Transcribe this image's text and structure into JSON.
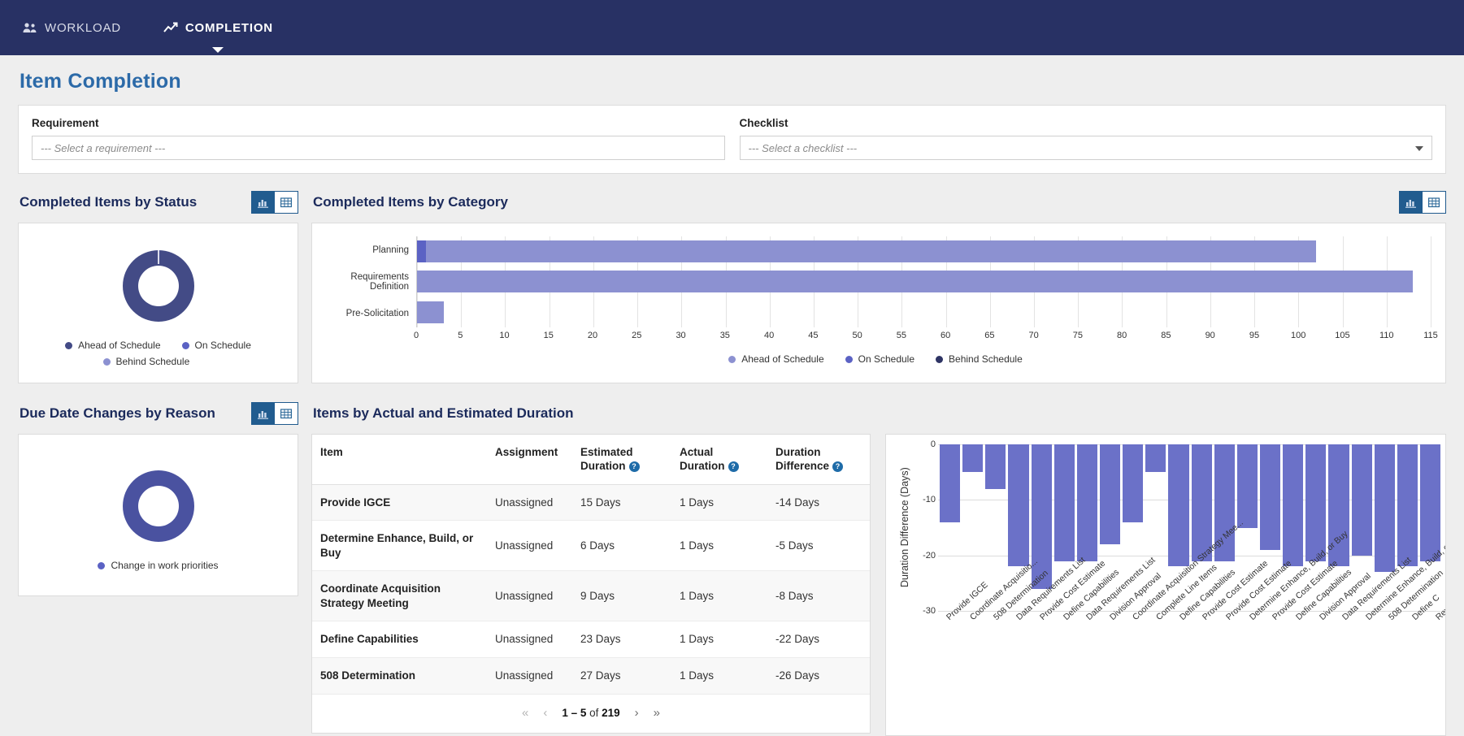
{
  "nav": {
    "items": [
      {
        "label": "WORKLOAD",
        "icon": "users-icon",
        "active": false
      },
      {
        "label": "COMPLETION",
        "icon": "line-chart-icon",
        "active": true
      }
    ]
  },
  "page": {
    "title": "Item Completion"
  },
  "filters": {
    "requirement": {
      "label": "Requirement",
      "value": "--- Select a requirement ---"
    },
    "checklist": {
      "label": "Checklist",
      "value": "--- Select a checklist ---"
    }
  },
  "colors": {
    "nav_bg": "#283164",
    "title_blue": "#2c6aa8",
    "toggle_active": "#215c8f",
    "ahead": "#8c91d1",
    "on": "#5b62c4",
    "behind": "#2e3464",
    "donut_status": "#434b86",
    "donut_reason": "#4a52a0",
    "dur_bar": "#6b71c8"
  },
  "status_panel": {
    "title": "Completed Items by Status",
    "toggles": [
      {
        "name": "chart-view",
        "icon": "bar-chart-icon",
        "active": true
      },
      {
        "name": "table-view",
        "icon": "table-icon",
        "active": false
      }
    ],
    "chart_data": {
      "type": "pie",
      "title": "Completed Items by Status",
      "labels": [
        "Ahead of Schedule",
        "On Schedule",
        "Behind Schedule"
      ],
      "values": [
        218,
        1,
        0
      ],
      "colors": [
        "#434b86",
        "#5b62c4",
        "#8c91d1"
      ],
      "legend": "bottom"
    }
  },
  "reason_panel": {
    "title": "Due Date Changes by Reason",
    "toggles": [
      {
        "name": "chart-view",
        "icon": "bar-chart-icon",
        "active": true
      },
      {
        "name": "table-view",
        "icon": "table-icon",
        "active": false
      }
    ],
    "chart_data": {
      "type": "pie",
      "title": "Due Date Changes by Reason",
      "labels": [
        "Change in work priorities"
      ],
      "values": [
        100
      ],
      "colors": [
        "#4a52a0"
      ],
      "legend": "bottom"
    }
  },
  "category_panel": {
    "title": "Completed Items by Category",
    "toggles": [
      {
        "name": "chart-view",
        "icon": "bar-chart-icon",
        "active": true
      },
      {
        "name": "table-view",
        "icon": "table-icon",
        "active": false
      }
    ],
    "chart_data": {
      "type": "bar",
      "orientation": "horizontal",
      "stacked": true,
      "title": "Completed Items by Category",
      "categories": [
        "Planning",
        "Requirements Definition",
        "Pre-Solicitation"
      ],
      "series": [
        {
          "name": "Ahead of Schedule",
          "color": "#8c91d1",
          "values": [
            101,
            113,
            3
          ]
        },
        {
          "name": "On Schedule",
          "color": "#5b62c4",
          "values": [
            1,
            0,
            0
          ]
        },
        {
          "name": "Behind Schedule",
          "color": "#2e3464",
          "values": [
            0,
            0,
            0
          ]
        }
      ],
      "xlabel": "",
      "ylabel": "",
      "xlim": [
        0,
        115
      ],
      "xticks": [
        0,
        5,
        10,
        15,
        20,
        25,
        30,
        35,
        40,
        45,
        50,
        55,
        60,
        65,
        70,
        75,
        80,
        85,
        90,
        95,
        100,
        105,
        110,
        115
      ],
      "grid": true,
      "legend": "bottom"
    }
  },
  "duration_panel": {
    "title": "Items by Actual and Estimated Duration",
    "table": {
      "columns": [
        {
          "label": "Item",
          "help": false
        },
        {
          "label": "Assignment",
          "help": false
        },
        {
          "label": "Estimated Duration",
          "help": true
        },
        {
          "label": "Actual Duration",
          "help": true
        },
        {
          "label": "Duration Difference",
          "help": true
        }
      ],
      "rows": [
        {
          "item": "Provide IGCE",
          "assignment": "Unassigned",
          "estimated": "15 Days",
          "actual": "1 Days",
          "difference": "-14 Days"
        },
        {
          "item": "Determine Enhance, Build, or Buy",
          "assignment": "Unassigned",
          "estimated": "6 Days",
          "actual": "1 Days",
          "difference": "-5 Days"
        },
        {
          "item": "Coordinate Acquisition Strategy Meeting",
          "assignment": "Unassigned",
          "estimated": "9 Days",
          "actual": "1 Days",
          "difference": "-8 Days"
        },
        {
          "item": "Define Capabilities",
          "assignment": "Unassigned",
          "estimated": "23 Days",
          "actual": "1 Days",
          "difference": "-22 Days"
        },
        {
          "item": "508 Determination",
          "assignment": "Unassigned",
          "estimated": "27 Days",
          "actual": "1 Days",
          "difference": "-26 Days"
        }
      ],
      "pagination": {
        "first_icon": "double-chevron-left-icon",
        "prev_icon": "chevron-left-icon",
        "range": "1 – 5",
        "of_text": "of",
        "total": "219",
        "next_icon": "chevron-right-icon",
        "last_icon": "double-chevron-right-icon"
      }
    },
    "chart_data": {
      "type": "bar",
      "title": "Items by Actual and Estimated Duration",
      "xlabel": "",
      "ylabel": "Duration Difference (Days)",
      "ylim": [
        -30,
        0
      ],
      "yticks": [
        0,
        -10,
        -20,
        -30
      ],
      "grid": true,
      "categories": [
        "Provide IGCE",
        "Coordinate Acquisitio...",
        "508 Determination",
        "Data Requirements List",
        "Provide Cost Estimate",
        "Define Capabilities",
        "Data Requirements List",
        "Division Approval",
        "Coordinate Acquisition Strategy Mee...",
        "Complete Line Items",
        "Define Capabilities",
        "Provide Cost Estimate",
        "Provide Cost Estimate",
        "Determine Enhance, Build, or Buy",
        "Provide Cost Estimate",
        "Define Capabilities",
        "Division Approval",
        "Data Requirements List",
        "Determine Enhance, Build, or Buy",
        "508 Determination",
        "Define C",
        "Review latest updat"
      ],
      "values": [
        -14,
        -5,
        -8,
        -22,
        -26,
        -21,
        -21,
        -18,
        -14,
        -5,
        -22,
        -21,
        -21,
        -15,
        -19,
        -22,
        -21,
        -22,
        -20,
        -23,
        -22,
        -21
      ]
    }
  }
}
